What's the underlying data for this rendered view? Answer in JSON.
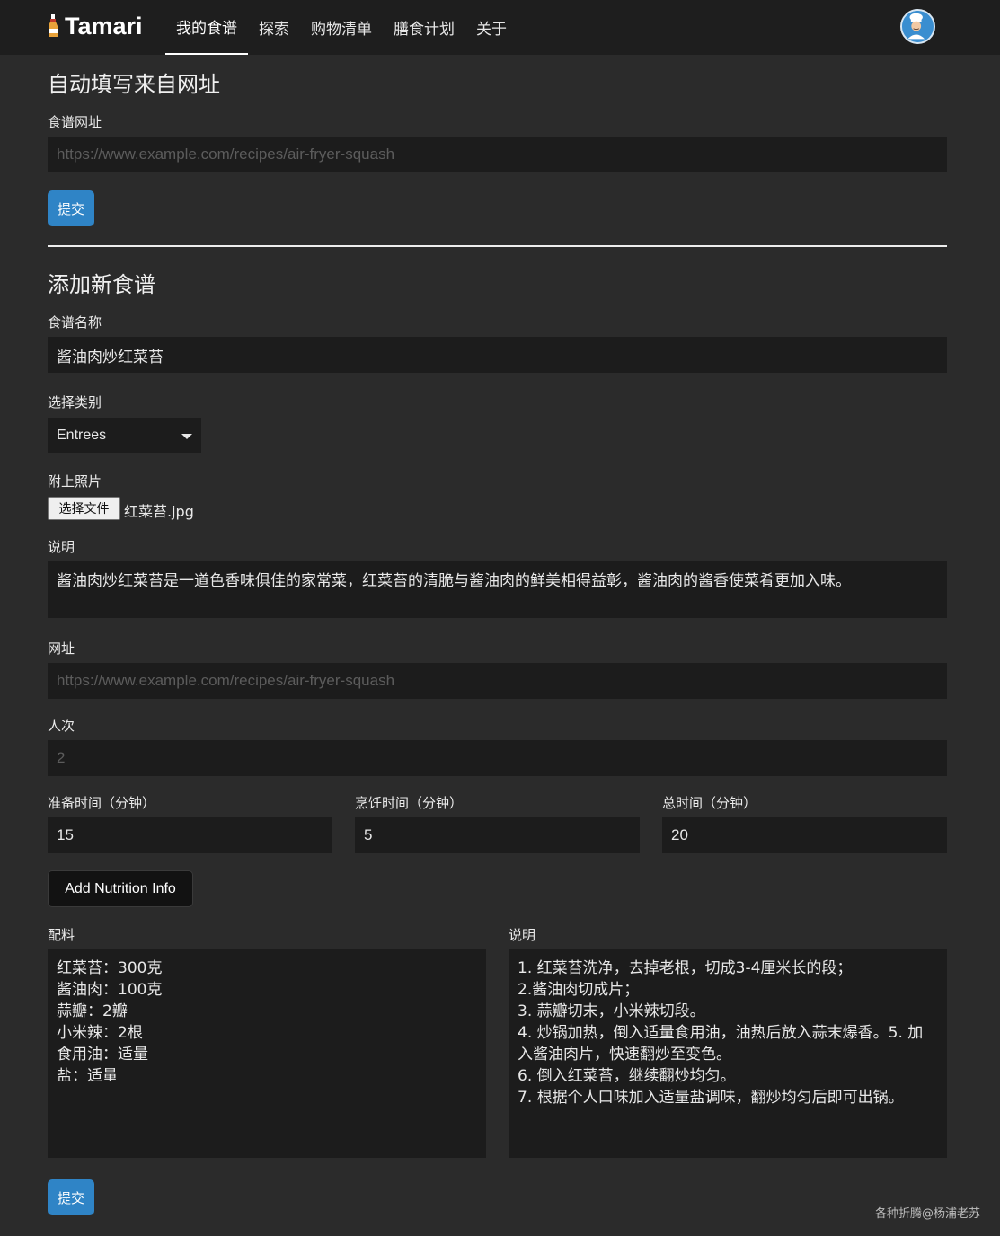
{
  "nav": {
    "brand": "Tamari",
    "links": [
      "我的食谱",
      "探索",
      "购物清单",
      "膳食计划",
      "关于"
    ]
  },
  "autofill": {
    "title": "自动填写来自网址",
    "url_label": "食谱网址",
    "url_placeholder": "https://www.example.com/recipes/air-fryer-squash",
    "submit": "提交"
  },
  "new_recipe": {
    "title": "添加新食谱",
    "name_label": "食谱名称",
    "name_value": "酱油肉炒红菜苔",
    "category_label": "选择类别",
    "category_value": "Entrees",
    "photo_label": "附上照片",
    "file_button": "选择文件",
    "file_name": "红菜苔.jpg",
    "description_label": "说明",
    "description_value": "酱油肉炒红菜苔是一道色香味俱佳的家常菜，红菜苔的清脆与酱油肉的鲜美相得益彰，酱油肉的酱香使菜肴更加入味。",
    "url_label": "网址",
    "url_placeholder": "https://www.example.com/recipes/air-fryer-squash",
    "servings_label": "人次",
    "servings_placeholder": "2",
    "prep_label": "准备时间（分钟）",
    "prep_value": "15",
    "cook_label": "烹饪时间（分钟）",
    "cook_value": "5",
    "total_label": "总时间（分钟）",
    "total_value": "20",
    "nutrition_button": "Add Nutrition Info",
    "ingredients_label": "配料",
    "ingredients_value": "红菜苔：300克\n酱油肉：100克\n蒜瓣：2瓣\n小米辣：2根\n食用油：适量\n盐：适量",
    "instructions_label": "说明",
    "instructions_value": "1. 红菜苔洗净，去掉老根，切成3-4厘米长的段；\n2.酱油肉切成片；\n3. 蒜瓣切末，小米辣切段。\n4. 炒锅加热，倒入适量食用油，油热后放入蒜末爆香。5. 加入酱油肉片，快速翻炒至变色。\n6. 倒入红菜苔，继续翻炒均匀。\n7. 根据个人口味加入适量盐调味，翻炒均匀后即可出锅。",
    "submit": "提交"
  },
  "watermark": "各种折腾@杨浦老苏",
  "colors": {
    "background": "#2b2b2b",
    "navbar": "#1e1e1e",
    "input": "#1c1c1c",
    "primary": "#2f84c6"
  }
}
